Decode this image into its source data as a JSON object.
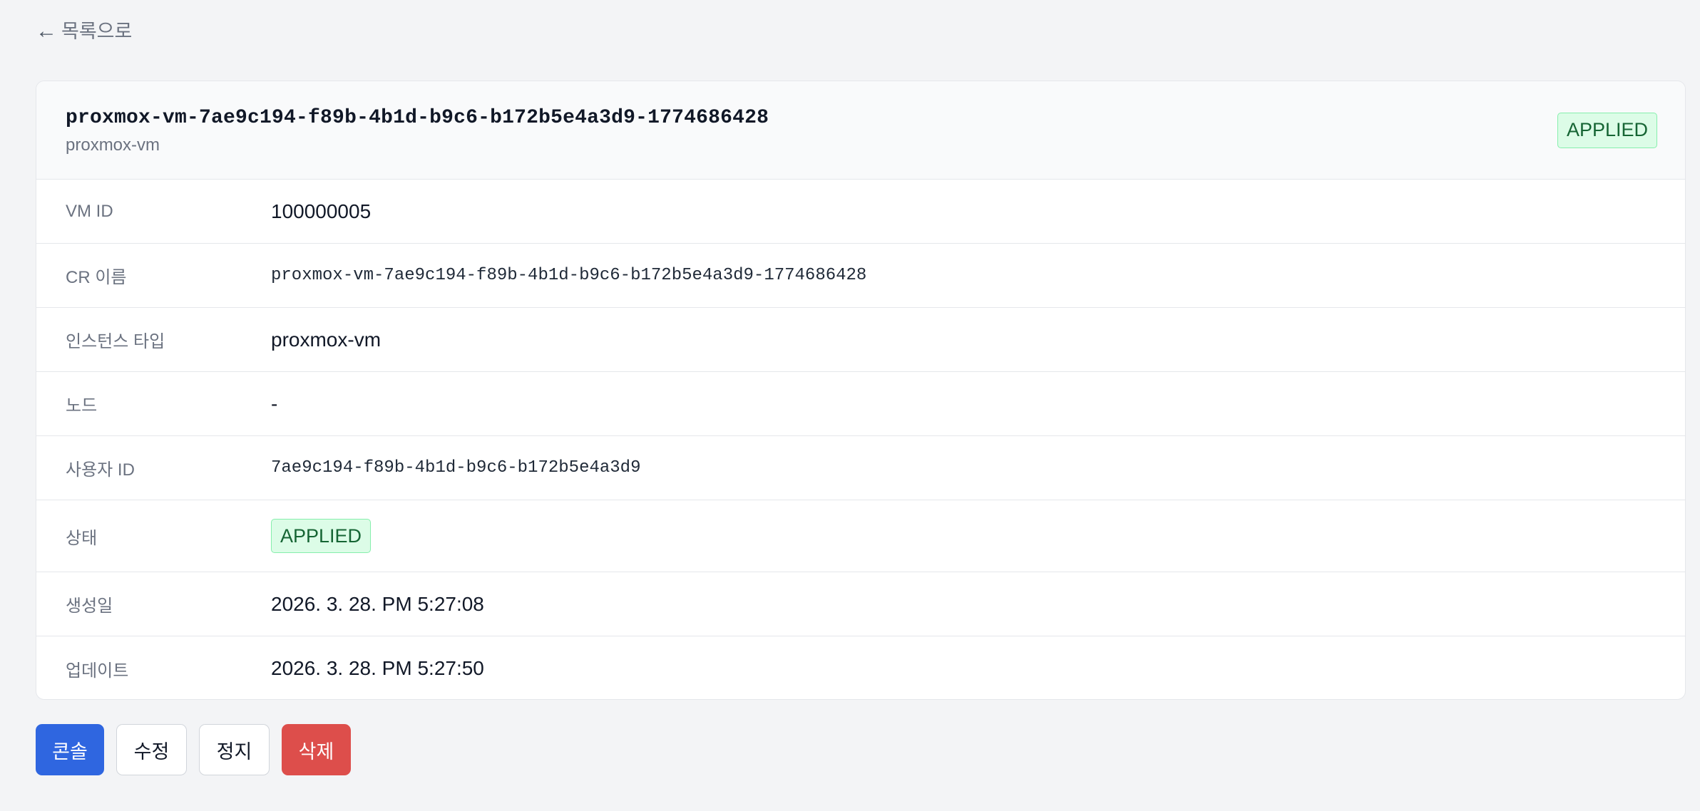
{
  "back_link": {
    "arrow": "←",
    "label": "목록으로"
  },
  "resource": {
    "title": "proxmox-vm-7ae9c194-f89b-4b1d-b9c6-b172b5e4a3d9-1774686428",
    "subtitle": "proxmox-vm",
    "status": "APPLIED"
  },
  "details": {
    "vm_id": {
      "label": "VM ID",
      "value": "100000005"
    },
    "cr_name": {
      "label": "CR 이름",
      "value": "proxmox-vm-7ae9c194-f89b-4b1d-b9c6-b172b5e4a3d9-1774686428"
    },
    "instance_type": {
      "label": "인스턴스 타입",
      "value": "proxmox-vm"
    },
    "node": {
      "label": "노드",
      "value": "-"
    },
    "user_id": {
      "label": "사용자 ID",
      "value": "7ae9c194-f89b-4b1d-b9c6-b172b5e4a3d9"
    },
    "status": {
      "label": "상태",
      "value": "APPLIED"
    },
    "created": {
      "label": "생성일",
      "value": "2026. 3. 28. PM 5:27:08"
    },
    "updated": {
      "label": "업데이트",
      "value": "2026. 3. 28. PM 5:27:50"
    }
  },
  "actions": {
    "console": "콘솔",
    "edit": "수정",
    "stop": "정지",
    "delete": "삭제"
  },
  "colors": {
    "primary": "#2f66e0",
    "danger": "#dd4e4b",
    "success_bg": "#dcfce7",
    "success_text": "#166534",
    "page_bg": "#f3f4f6"
  }
}
